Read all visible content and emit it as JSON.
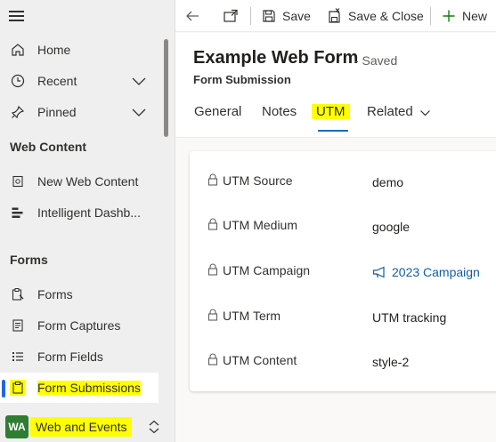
{
  "sidebar": {
    "items_top": [
      {
        "label": "Home",
        "icon": "home-icon"
      },
      {
        "label": "Recent",
        "icon": "clock-icon"
      },
      {
        "label": "Pinned",
        "icon": "pin-icon"
      }
    ],
    "section_web": "Web Content",
    "web_items": [
      {
        "label": "New Web Content",
        "icon": "web-page-icon"
      },
      {
        "label": "Intelligent Dashb...",
        "icon": "dashboard-icon"
      }
    ],
    "section_forms": "Forms",
    "form_items": [
      {
        "label": "Forms",
        "icon": "form-icon"
      },
      {
        "label": "Form Captures",
        "icon": "capture-icon"
      },
      {
        "label": "Form Fields",
        "icon": "list-icon"
      },
      {
        "label": "Form Submissions",
        "icon": "clipboard-icon"
      }
    ],
    "area": {
      "badge": "WA",
      "label": "Web and Events"
    }
  },
  "commandbar": {
    "save": "Save",
    "save_close": "Save & Close",
    "new": "New"
  },
  "record": {
    "title": "Example Web Form",
    "status": "- Saved",
    "entity": "Form Submission",
    "tabs": [
      "General",
      "Notes",
      "UTM",
      "Related"
    ],
    "active_tab": "UTM"
  },
  "fields": [
    {
      "label": "UTM Source",
      "value": "demo"
    },
    {
      "label": "UTM Medium",
      "value": "google"
    },
    {
      "label": "UTM Campaign",
      "value": "2023 Campaign"
    },
    {
      "label": "UTM Term",
      "value": "UTM tracking"
    },
    {
      "label": "UTM Content",
      "value": "style-2"
    }
  ],
  "colors": {
    "highlight": "#ffff00",
    "accent": "#0f6cbd",
    "link": "#115ea3",
    "area_badge": "#2e7d32",
    "new_plus": "#107c10"
  }
}
